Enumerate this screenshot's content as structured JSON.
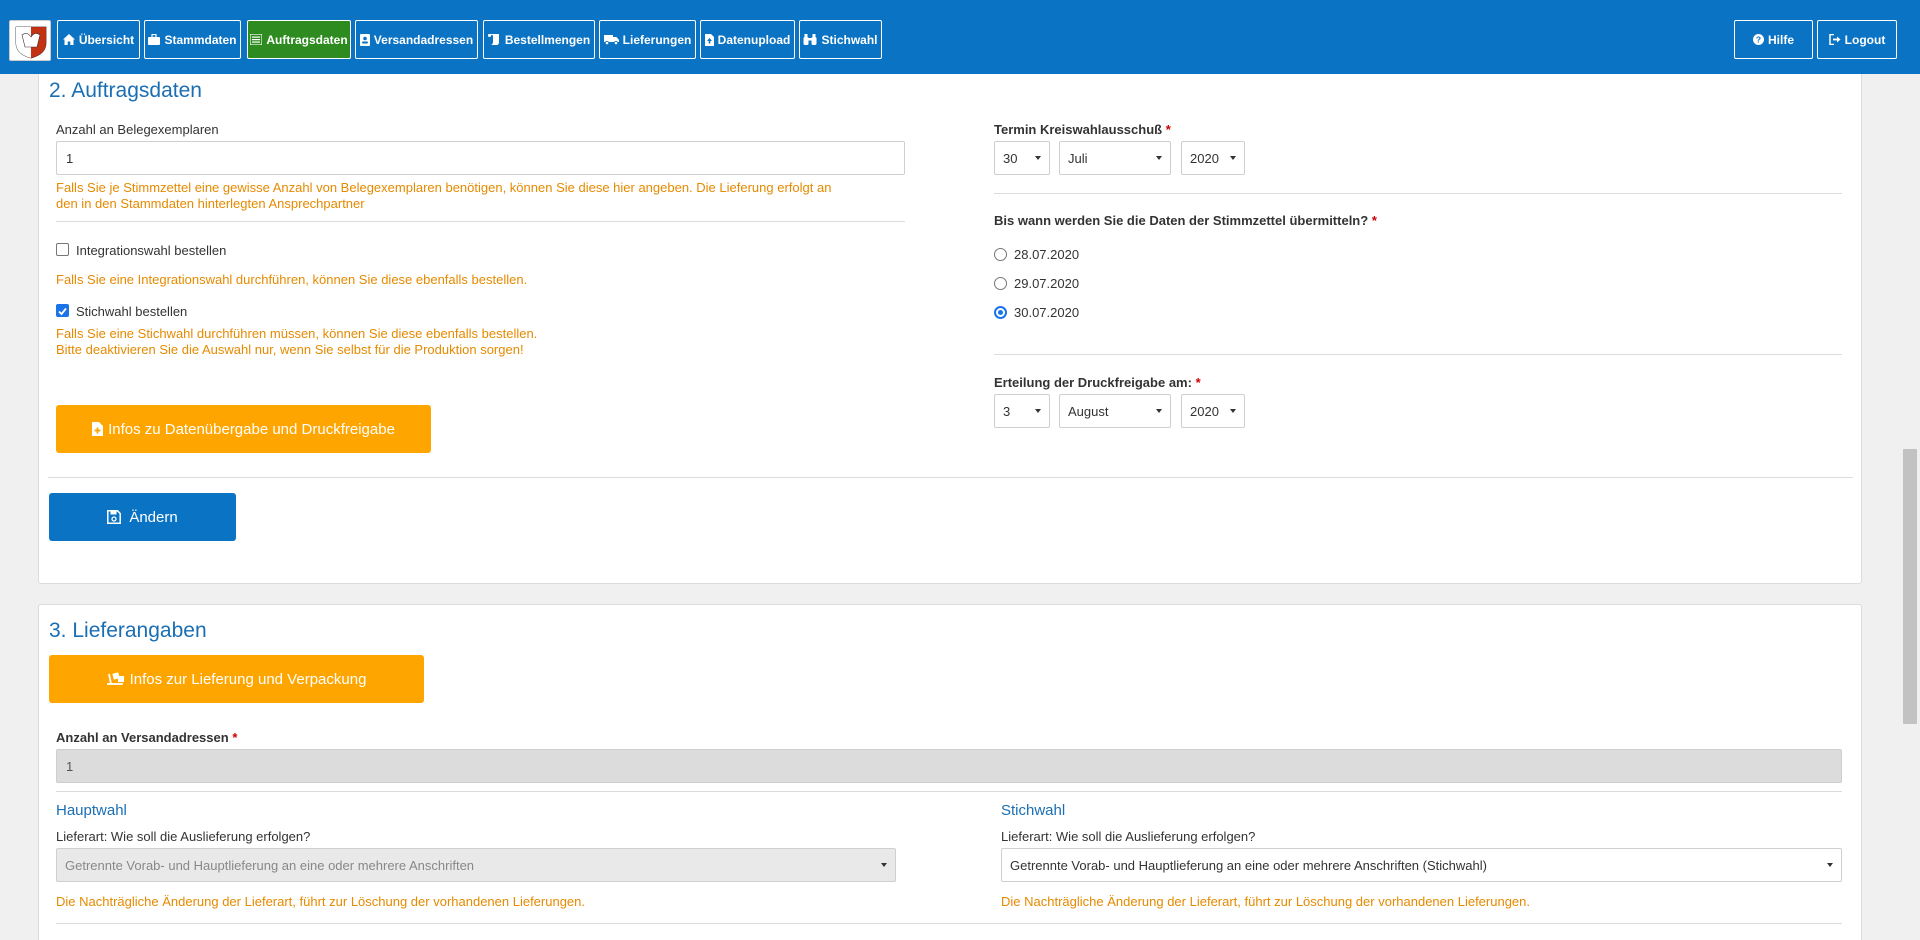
{
  "nav": {
    "items": [
      {
        "label": "Übersicht",
        "icon": "home-icon"
      },
      {
        "label": "Stammdaten",
        "icon": "briefcase-icon"
      },
      {
        "label": "Auftragsdaten",
        "icon": "list-icon"
      },
      {
        "label": "Versandadressen",
        "icon": "address-card-icon"
      },
      {
        "label": "Bestellmengen",
        "icon": "scroll-icon"
      },
      {
        "label": "Lieferungen",
        "icon": "truck-icon"
      },
      {
        "label": "Datenupload",
        "icon": "file-upload-icon"
      },
      {
        "label": "Stichwahl",
        "icon": "binoculars-icon"
      }
    ],
    "active": "Auftragsdaten",
    "help_label": "Hilfe",
    "logout_label": "Logout"
  },
  "auftragsdaten": {
    "title": "2. Auftragsdaten",
    "belegexemplare_label": "Anzahl an Belegexemplaren",
    "belegexemplare_value": "1",
    "belegexemplare_hint_1": "Falls Sie je Stimmzettel eine gewisse Anzahl von Belegexemplaren benötigen, können Sie diese hier angeben. Die Lieferung erfolgt an",
    "belegexemplare_hint_2": "den in den Stammdaten hinterlegten Ansprechpartner",
    "integrationswahl_label": "Integrationswahl bestellen",
    "integrationswahl_checked": false,
    "integrationswahl_hint": "Falls Sie eine Integrationswahl durchführen, können Sie diese ebenfalls bestellen.",
    "stichwahl_label": "Stichwahl bestellen",
    "stichwahl_checked": true,
    "stichwahl_hint_1": "Falls Sie eine Stichwahl durchführen müssen, können Sie diese ebenfalls bestellen.",
    "stichwahl_hint_2": "Bitte deaktivieren Sie die Auswahl nur, wenn Sie selbst für die Produktion sorgen!",
    "info_button_label": "Infos zu Datenübergabe und Druckfreigabe",
    "termin_label": "Termin Kreiswahlausschuß",
    "termin_day": "30",
    "termin_month": "Juli",
    "termin_year": "2020",
    "uebermittlung_question": "Bis wann werden Sie die Daten der Stimmzettel übermitteln?",
    "uebermittlung_options": [
      "28.07.2020",
      "29.07.2020",
      "30.07.2020"
    ],
    "uebermittlung_selected": "30.07.2020",
    "druckfreigabe_label": "Erteilung der Druckfreigabe am:",
    "druckfreigabe_day": "3",
    "druckfreigabe_month": "August",
    "druckfreigabe_year": "2020",
    "required_marker": "*",
    "save_button_label": "Ändern"
  },
  "lieferangaben": {
    "title": "3. Lieferangaben",
    "info_button_label": "Infos zur Lieferung und Verpackung",
    "versandadressen_label": "Anzahl an Versandadressen",
    "versandadressen_value": "1",
    "hauptwahl": {
      "title": "Hauptwahl",
      "lieferart_label": "Lieferart: Wie soll die Auslieferung erfolgen?",
      "lieferart_value": "Getrennte Vorab- und Hauptlieferung an eine oder mehrere Anschriften",
      "hint": "Die Nachträgliche Änderung der Lieferart, führt zur Löschung der vorhandenen Lieferungen."
    },
    "stichwahl": {
      "title": "Stichwahl",
      "lieferart_label": "Lieferart: Wie soll die Auslieferung erfolgen?",
      "lieferart_value": "Getrennte Vorab- und Hauptlieferung an eine oder mehrere Anschriften (Stichwahl)",
      "hint": "Die Nachträgliche Änderung der Lieferart, führt zur Löschung der vorhandenen Lieferungen."
    }
  },
  "colors": {
    "nav_blue": "#0a73c4",
    "active_green": "#2e8b1f",
    "orange": "#ffa500",
    "hint_orange": "#e68a00",
    "heading_blue": "#1a6eb4"
  }
}
